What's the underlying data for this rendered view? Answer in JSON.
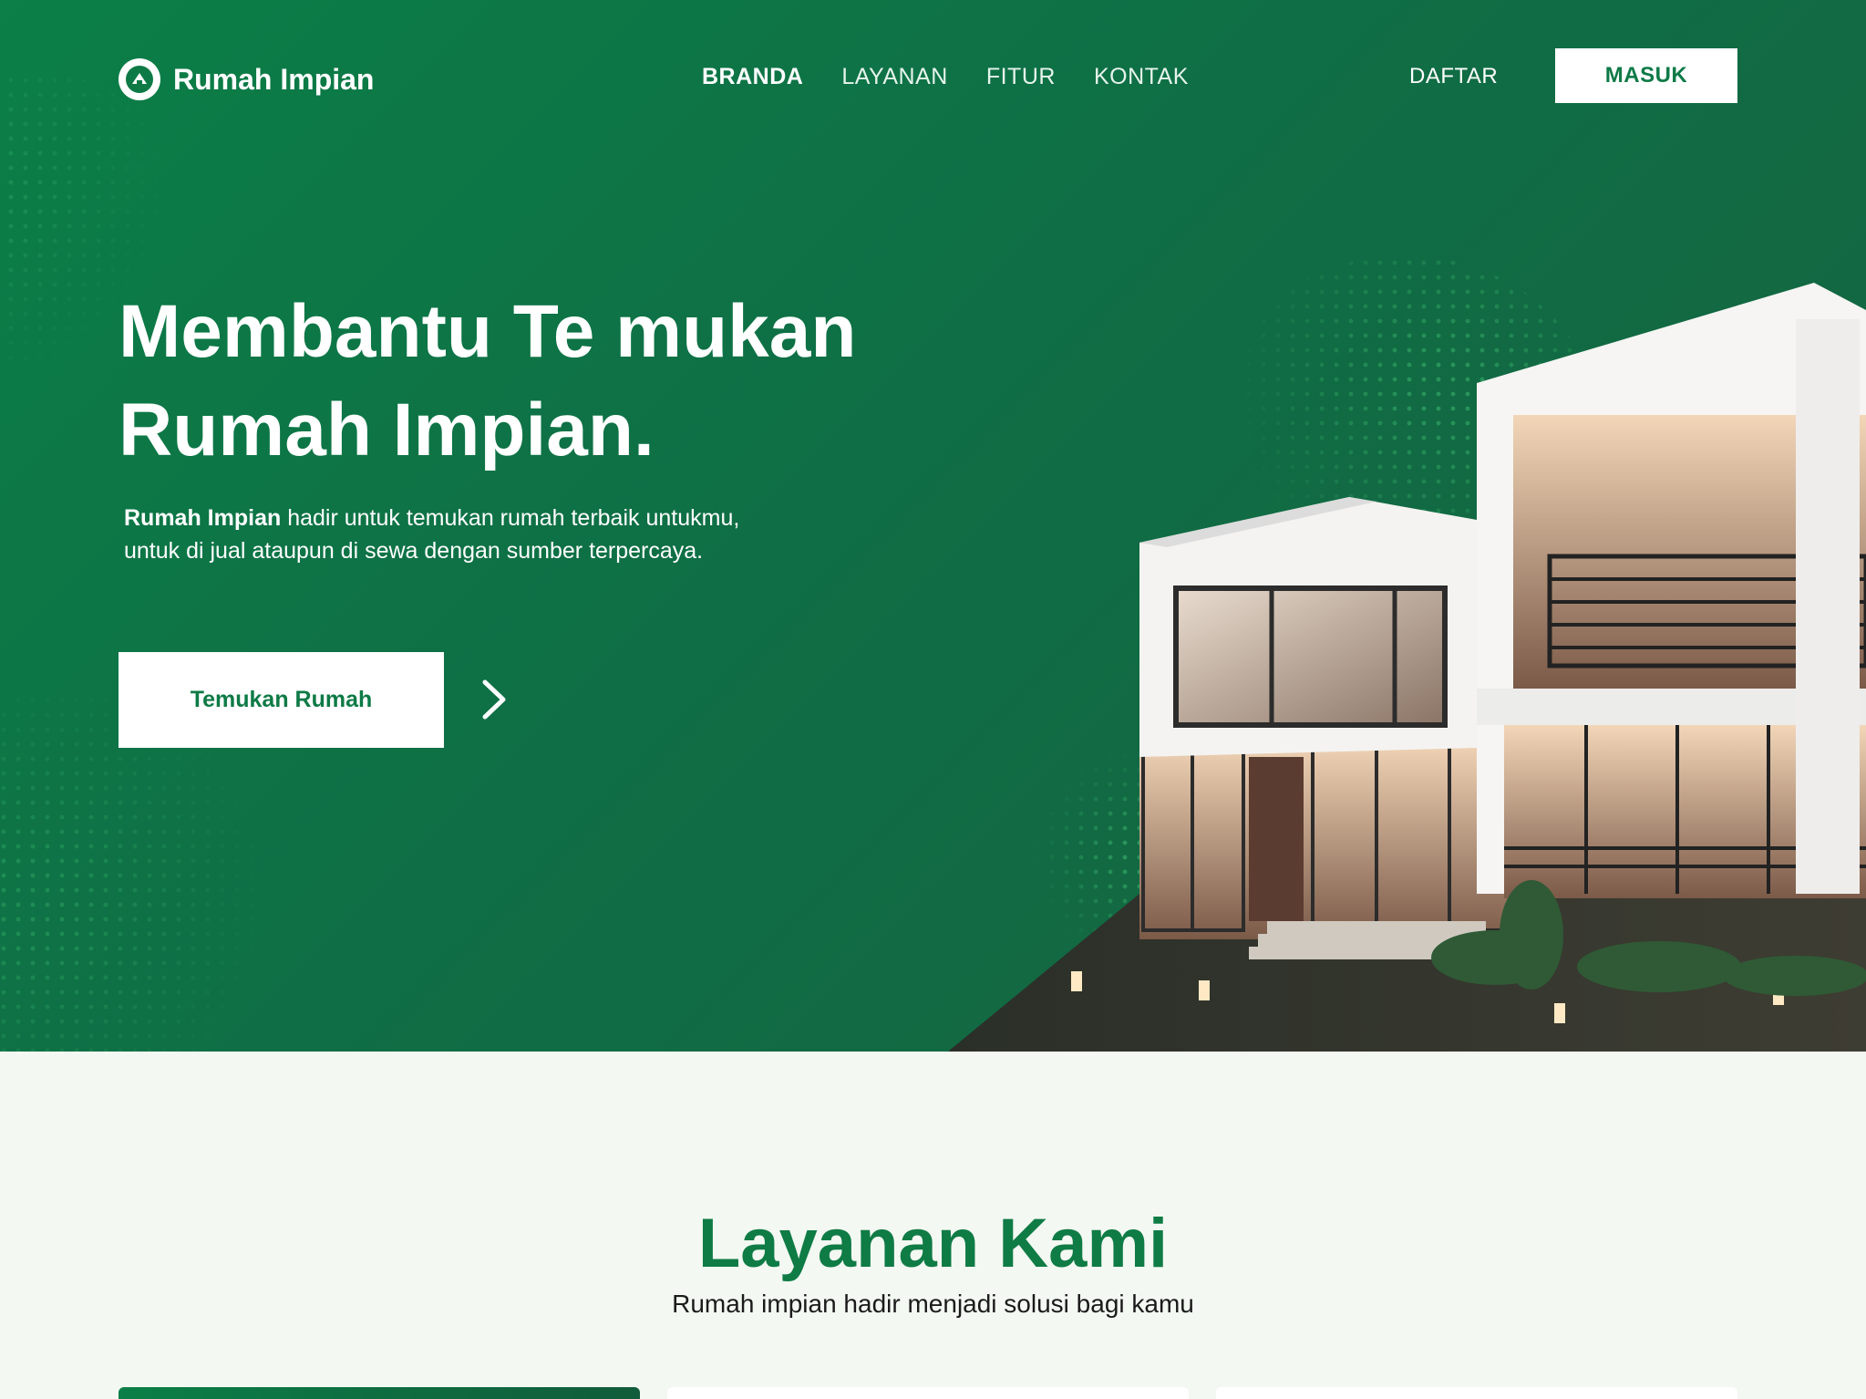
{
  "brand": {
    "name": "Rumah Impian"
  },
  "nav": {
    "items": [
      {
        "label": "BRANDA",
        "active": true
      },
      {
        "label": "LAYANAN",
        "active": false
      },
      {
        "label": "FITUR",
        "active": false
      },
      {
        "label": "KONTAK",
        "active": false
      }
    ],
    "daftar": "DAFTAR",
    "masuk": "MASUK"
  },
  "hero": {
    "headline_line1": "Membantu Te mukan",
    "headline_line2": "Rumah Impian.",
    "sub_brand": "Rumah Impian",
    "sub_text": " hadir untuk temukan rumah terbaik untukmu, untuk di jual ataupun di sewa dengan sumber terpercaya.",
    "cta": "Temukan Rumah"
  },
  "services": {
    "title": "Layanan Kami",
    "subtitle": "Rumah impian hadir menjadi solusi bagi kamu"
  },
  "colors": {
    "primary": "#0b7f47",
    "primary_dark": "#115c3a",
    "page_bg": "#f3f8f2"
  },
  "icons": {
    "logo": "house-leaf-icon",
    "cta_arrow": "chevron-right-icon"
  }
}
